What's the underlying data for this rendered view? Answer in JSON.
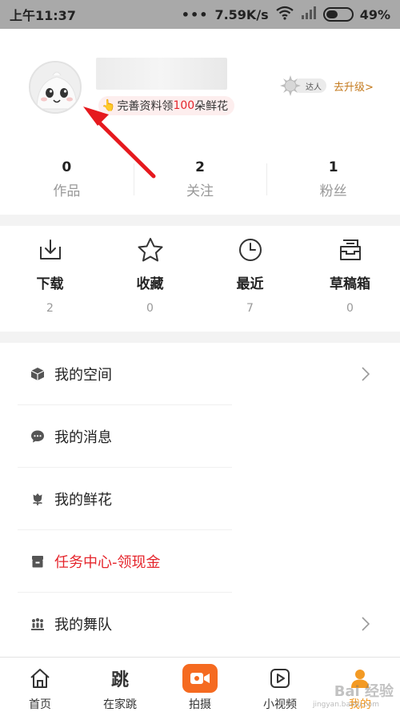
{
  "status_bar": {
    "time": "上午11:37",
    "net_speed": "7.59K/s",
    "battery": "49%",
    "battery_level": 0.49
  },
  "profile": {
    "tip_prefix": "完善资料领",
    "tip_highlight": "100",
    "tip_suffix": "朵鲜花",
    "badge_label": "达人",
    "upgrade_link": "去升级>"
  },
  "stats": [
    {
      "num": "0",
      "label": "作品"
    },
    {
      "num": "2",
      "label": "关注"
    },
    {
      "num": "1",
      "label": "粉丝"
    }
  ],
  "quick_actions": [
    {
      "label": "下载",
      "count": "2",
      "icon": "download-icon"
    },
    {
      "label": "收藏",
      "count": "0",
      "icon": "star-icon"
    },
    {
      "label": "最近",
      "count": "7",
      "icon": "clock-icon"
    },
    {
      "label": "草稿箱",
      "count": "0",
      "icon": "drafts-icon"
    }
  ],
  "menu": [
    {
      "label": "我的空间",
      "icon": "cube-icon",
      "has_chevron": true
    },
    {
      "label": "我的消息",
      "icon": "chat-icon",
      "has_chevron": false
    },
    {
      "label": "我的鲜花",
      "icon": "flower-icon",
      "has_chevron": false
    },
    {
      "label": "任务中心-领现金",
      "icon": "task-icon",
      "has_chevron": false,
      "highlight": true
    },
    {
      "label": "我的舞队",
      "icon": "team-icon",
      "has_chevron": true
    }
  ],
  "tabs": [
    {
      "label": "首页",
      "icon": "home-icon"
    },
    {
      "label": "在家跳",
      "icon": "tiao-icon",
      "glyph": "跳"
    },
    {
      "label": "拍摄",
      "icon": "camera-icon"
    },
    {
      "label": "小视频",
      "icon": "video-play-icon"
    },
    {
      "label": "我的",
      "icon": "user-icon",
      "active": true
    }
  ],
  "watermark": {
    "text": "Bai 经验",
    "sub": "jingyan.baidu.com"
  },
  "colors": {
    "accent_red": "#e5252c",
    "upgrade_orange": "#c47a1e",
    "tab_active": "#f39a24",
    "shoot_button": "#f56a20",
    "status_bar": "#a9a9a9"
  }
}
